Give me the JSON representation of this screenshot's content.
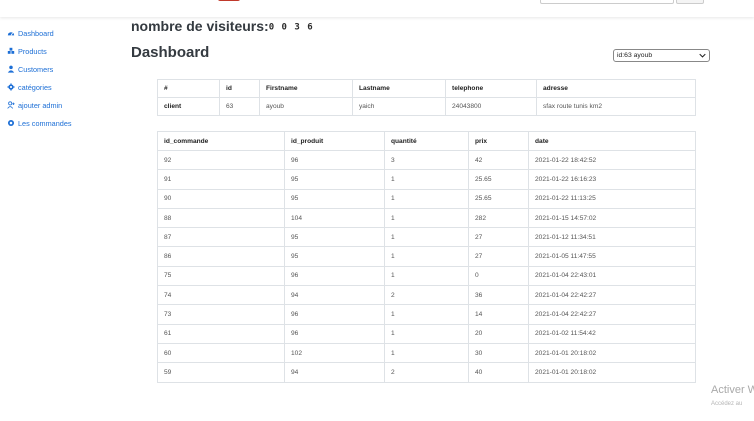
{
  "sidebar": {
    "items": [
      {
        "label": "Dashboard",
        "icon": "dashboard-icon"
      },
      {
        "label": "Products",
        "icon": "products-icon"
      },
      {
        "label": "Customers",
        "icon": "customers-icon"
      },
      {
        "label": "catégories",
        "icon": "gear-icon"
      },
      {
        "label": "ajouter admin",
        "icon": "add-user-icon"
      },
      {
        "label": "Les commandes",
        "icon": "dot-icon"
      }
    ],
    "link_color": "#1d6fd6"
  },
  "visitors": {
    "label": "nombre de visiteurs:",
    "count": "0 0 3 6"
  },
  "page_title": "Dashboard",
  "client_select": {
    "selected": "id:63 ayoub"
  },
  "client_table": {
    "headers": [
      "#",
      "id",
      "Firstname",
      "Lastname",
      "telephone",
      "adresse"
    ],
    "row": [
      "client",
      "63",
      "ayoub",
      "yaich",
      "24043800",
      "sfax route tunis km2"
    ]
  },
  "orders_table": {
    "headers": [
      "id_commande",
      "id_produit",
      "quantité",
      "prix",
      "date"
    ],
    "rows": [
      [
        "92",
        "96",
        "3",
        "42",
        "2021-01-22 18:42:52"
      ],
      [
        "91",
        "95",
        "1",
        "25.65",
        "2021-01-22 16:16:23"
      ],
      [
        "90",
        "95",
        "1",
        "25.65",
        "2021-01-22 11:13:25"
      ],
      [
        "88",
        "104",
        "1",
        "282",
        "2021-01-15 14:57:02"
      ],
      [
        "87",
        "95",
        "1",
        "27",
        "2021-01-12 11:34:51"
      ],
      [
        "86",
        "95",
        "1",
        "27",
        "2021-01-05 11:47:55"
      ],
      [
        "75",
        "96",
        "1",
        "0",
        "2021-01-04 22:43:01"
      ],
      [
        "74",
        "94",
        "2",
        "36",
        "2021-01-04 22:42:27"
      ],
      [
        "73",
        "96",
        "1",
        "14",
        "2021-01-04 22:42:27"
      ],
      [
        "61",
        "96",
        "1",
        "20",
        "2021-01-02 11:54:42"
      ],
      [
        "60",
        "102",
        "1",
        "30",
        "2021-01-01 20:18:02"
      ],
      [
        "59",
        "94",
        "2",
        "40",
        "2021-01-01 20:18:02"
      ]
    ]
  },
  "watermark": {
    "title": "Activer W",
    "subtitle": "Accédez au"
  }
}
